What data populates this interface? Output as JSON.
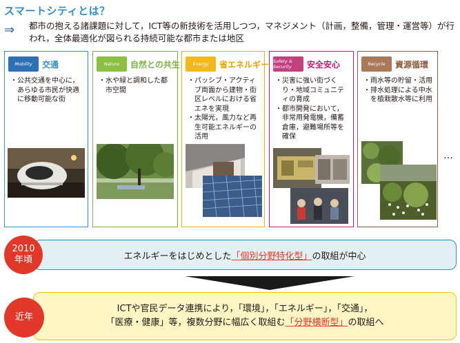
{
  "header": {
    "title": "スマートシティとは？",
    "arrow": "⇒",
    "description": "都市の抱える諸課題に対して，ICT等の新技術を活用しつつ，マネジメント（計画，整備，管理・運営等）が行われ，全体最適化が図られる持続可能な都市または地区"
  },
  "cards": [
    {
      "icon_label": "Mobility",
      "title": "交通",
      "bullets": [
        "・公共交通を中心に，あらゆる市民が快適に移動可能な街"
      ],
      "color": "#2e8fc8",
      "icon_bg": "#2e6fb5"
    },
    {
      "icon_label": "Nature",
      "title": "自然との共生",
      "bullets": [
        "・水や緑と調和した都市空間"
      ],
      "color": "#7cb342",
      "icon_bg": "#8bbf3f"
    },
    {
      "icon_label": "Energy",
      "title": "省エネルギー",
      "bullets": [
        "・パッシブ・アクティブ両面から建物・街区レベルにおける省エネを実現",
        "・太陽光，風力など再生可能エネルギーの活用"
      ],
      "color": "#e8b400",
      "icon_bg": "#f3b81e"
    },
    {
      "icon_label": "Safety & Security",
      "title": "安全安心",
      "bullets": [
        "・災害に強い街づくり・地域コミュニティの育成",
        "・都市開発において，非常用発電機，備蓄倉庫，避難場所等を確保"
      ],
      "color": "#c2187a",
      "icon_bg": "#c2407e"
    },
    {
      "icon_label": "Recycle",
      "title": "資源循環",
      "bullets": [
        "・雨水等の貯留・活用",
        "・排水処理による中水を植栽散水等に利用"
      ],
      "color": "#8d5a3b",
      "icon_bg": "#a87a5a"
    }
  ],
  "ellipsis": "…",
  "era_2010": {
    "label_line1": "2010",
    "label_line2": "年頃",
    "text_before": "エネルギーをはじめとした",
    "highlight": "「個別分野特化型」",
    "text_after": "の取組が中心"
  },
  "era_recent": {
    "label": "近年",
    "line1": "ICTや官民データ連携により，「環境」，「エネルギー」，「交通」，",
    "line2_before": "「医療・健康」等，複数分野に幅広く取組む",
    "highlight": "「分野横断型」",
    "line2_after": "の取組へ"
  },
  "colors": {
    "title_blue": "#2e8fc8",
    "accent_red": "#e2382b",
    "band1_bg": "#e2eff3",
    "band1_border": "#2e8fc8",
    "band2_bg": "#fdf5c4",
    "band2_border": "#f0c419"
  }
}
